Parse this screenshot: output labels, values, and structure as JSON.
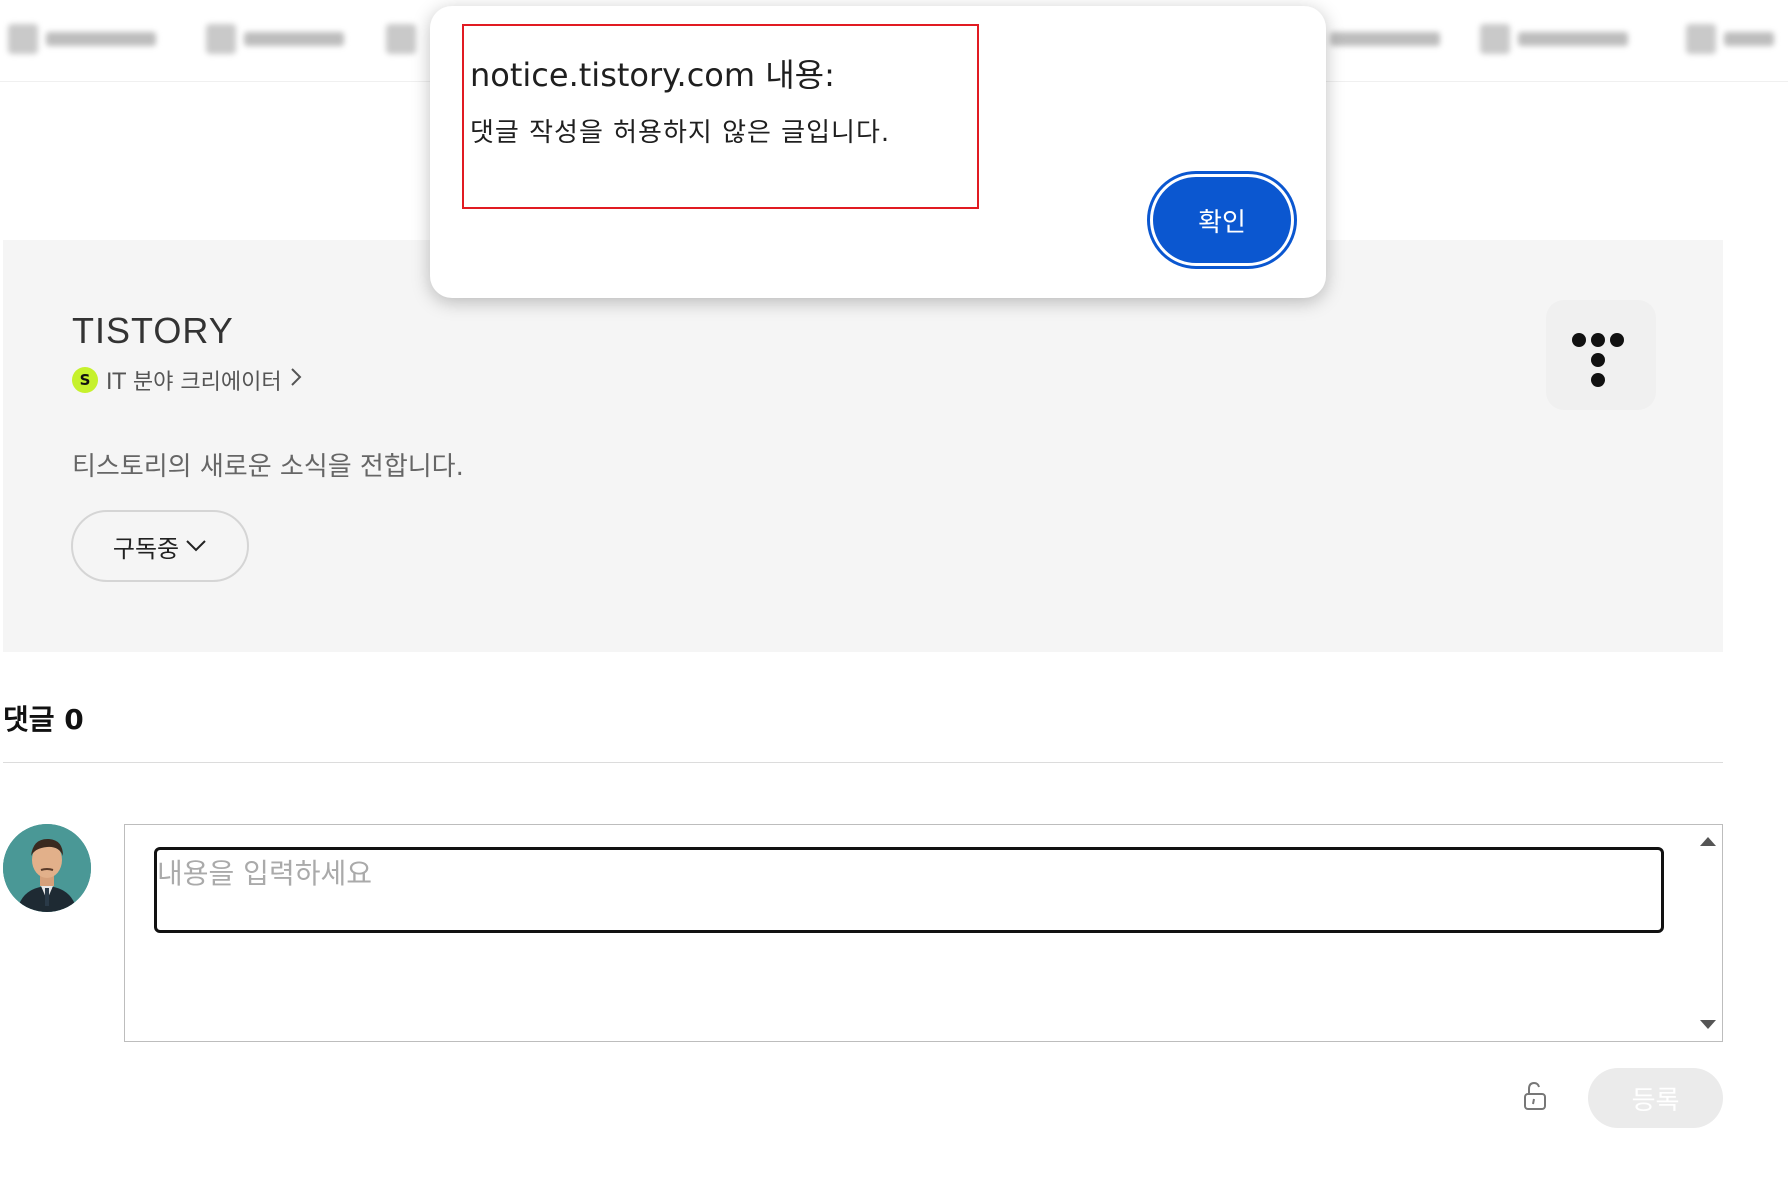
{
  "blog": {
    "title": "TISTORY",
    "creator_badge": "S",
    "creator_label": "IT 분야 크리에이터",
    "description": "티스토리의 새로운 소식을 전합니다.",
    "subscribe_label": "구독중"
  },
  "comments": {
    "title": "댓글 0",
    "input_placeholder": "내용을 입력하세요",
    "submit_label": "등록"
  },
  "dialog": {
    "title": "notice.tistory.com 내용:",
    "message": "댓글 작성을 허용하지 않은 글입니다.",
    "ok_label": "확인"
  },
  "colors": {
    "dialog_button": "#0b57d0",
    "highlight_border": "#e11b22",
    "creator_badge": "#c6f12c",
    "card_background": "#f5f5f5"
  },
  "icons": [
    "chevron-right-icon",
    "chevron-down-icon",
    "tistory-logo-icon",
    "lock-icon",
    "avatar"
  ]
}
